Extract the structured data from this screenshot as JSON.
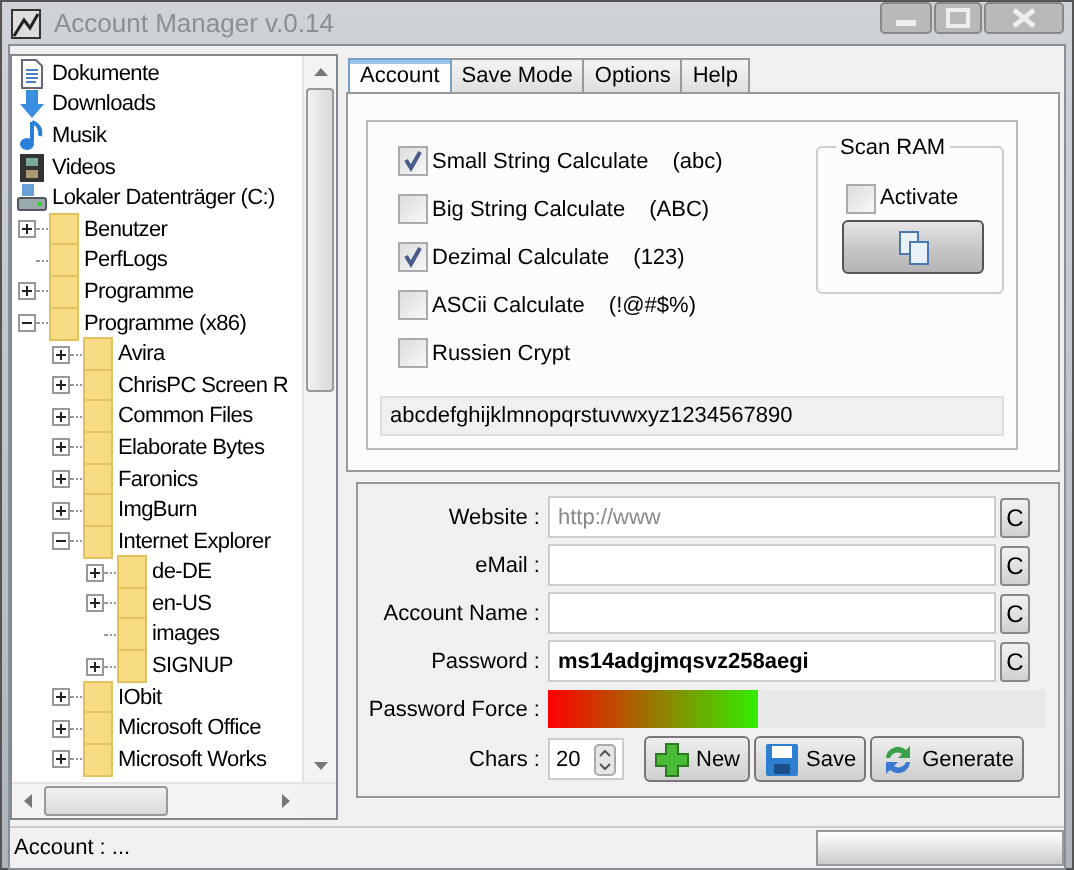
{
  "window": {
    "title": "Account Manager v.0.14"
  },
  "tree": [
    {
      "label": "Dokumente",
      "kind": "documents"
    },
    {
      "label": "Downloads",
      "kind": "downloads"
    },
    {
      "label": "Musik",
      "kind": "music"
    },
    {
      "label": "Videos",
      "kind": "videos"
    },
    {
      "label": "Lokaler Datenträger (C:)",
      "kind": "drive",
      "children": [
        {
          "label": "Benutzer",
          "kind": "folder",
          "expanded": false
        },
        {
          "label": "PerfLogs",
          "kind": "folder"
        },
        {
          "label": "Programme",
          "kind": "folder",
          "expanded": false
        },
        {
          "label": "Programme (x86)",
          "kind": "folder",
          "expanded": true,
          "children": [
            {
              "label": "Avira",
              "kind": "folder",
              "expanded": false
            },
            {
              "label": "ChrisPC Screen R",
              "kind": "folder",
              "expanded": false
            },
            {
              "label": "Common Files",
              "kind": "folder",
              "expanded": false
            },
            {
              "label": "Elaborate Bytes",
              "kind": "folder",
              "expanded": false
            },
            {
              "label": "Faronics",
              "kind": "folder",
              "expanded": false
            },
            {
              "label": "ImgBurn",
              "kind": "folder",
              "expanded": false
            },
            {
              "label": "Internet Explorer",
              "kind": "folder",
              "expanded": true,
              "children": [
                {
                  "label": "de-DE",
                  "kind": "folder",
                  "expanded": false
                },
                {
                  "label": "en-US",
                  "kind": "folder",
                  "expanded": false
                },
                {
                  "label": "images",
                  "kind": "folder"
                },
                {
                  "label": "SIGNUP",
                  "kind": "folder",
                  "expanded": false
                }
              ]
            },
            {
              "label": "IObit",
              "kind": "folder",
              "expanded": false
            },
            {
              "label": "Microsoft Office",
              "kind": "folder",
              "expanded": false
            },
            {
              "label": "Microsoft Works",
              "kind": "folder",
              "expanded": false
            }
          ]
        }
      ]
    }
  ],
  "tabs": [
    {
      "label": "Account",
      "selected": true
    },
    {
      "label": "Save Mode",
      "selected": false
    },
    {
      "label": "Options",
      "selected": false
    },
    {
      "label": "Help",
      "selected": false
    }
  ],
  "options": [
    {
      "label": "Small String Calculate",
      "sample": "(abc)",
      "checked": true
    },
    {
      "label": "Big String Calculate",
      "sample": "(ABC)",
      "checked": false
    },
    {
      "label": "Dezimal Calculate",
      "sample": "(123)",
      "checked": true
    },
    {
      "label": "ASCii Calculate",
      "sample": "(!@#$%)",
      "checked": false
    },
    {
      "label": "Russien Crypt",
      "checked": false
    }
  ],
  "scan_ram": {
    "title": "Scan RAM",
    "activate": {
      "label": "Activate",
      "checked": false
    }
  },
  "charset": "abcdefghijklmnopqrstuvwxyz1234567890",
  "fields": [
    {
      "label": "Website :",
      "placeholder": "http://www",
      "clear": "C"
    },
    {
      "label": "eMail :",
      "clear": "C"
    },
    {
      "label": "Account Name :",
      "clear": "C"
    },
    {
      "label": "Password :",
      "value": "ms14adgjmqsvz258aegi",
      "clear": "C"
    }
  ],
  "password_force": {
    "label": "Password Force :",
    "level": 0.42
  },
  "chars": {
    "label": "Chars :",
    "value": "20"
  },
  "buttons": [
    {
      "label": "New",
      "kind": "new"
    },
    {
      "label": "Save",
      "kind": "save"
    },
    {
      "label": "Generate",
      "kind": "generate"
    }
  ],
  "status_bar": {
    "text": "Account : ..."
  }
}
